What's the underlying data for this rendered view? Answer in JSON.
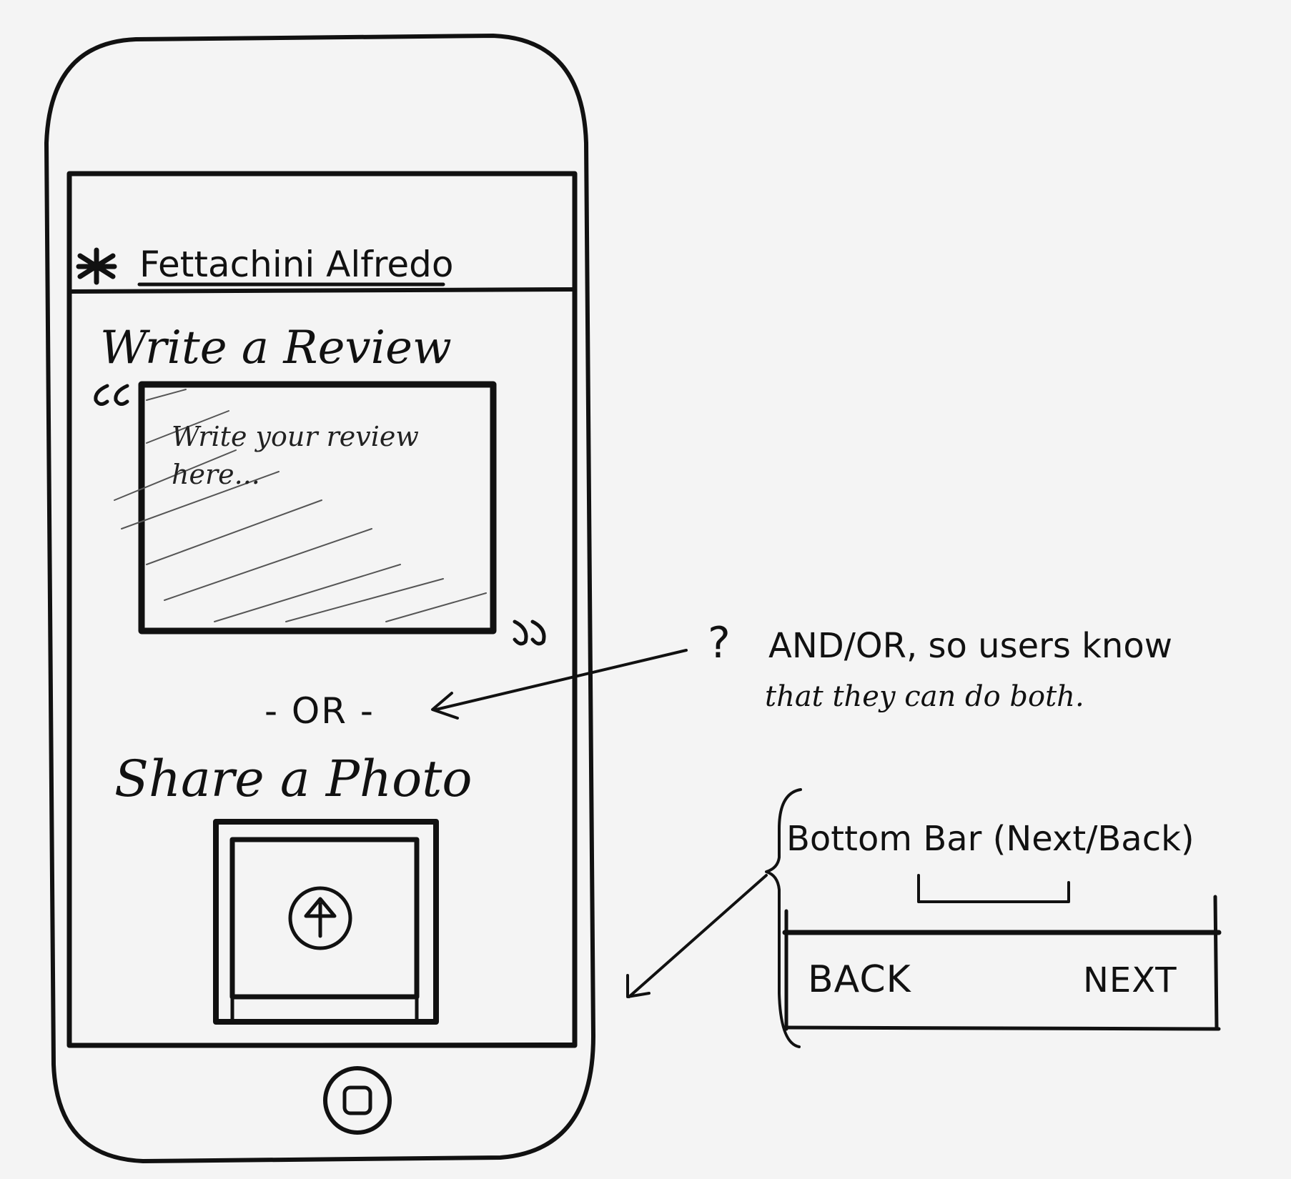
{
  "phone": {
    "header": {
      "title": "Fettachini Alfredo",
      "star_icon": "asterisk-icon"
    },
    "review_section": {
      "heading": "Write a Review",
      "placeholder": "Write your review here...",
      "quote_open_icon": "quote-open-icon",
      "quote_close_icon": "quote-close-icon"
    },
    "separator": "- OR -",
    "photo_section": {
      "heading": "Share a Photo",
      "upload_icon": "upload-arrow-icon"
    },
    "home_button_icon": "home-button-icon"
  },
  "annotations": {
    "or_note": {
      "mark": "?",
      "line1": "AND/OR, so users know",
      "line2": "that they can do both."
    },
    "bottom_bar_note": {
      "label": "Bottom Bar (Next/Back)",
      "back": "BACK",
      "next": "NEXT"
    }
  },
  "colors": {
    "ink": "#111111",
    "paper": "#f4f4f4"
  }
}
